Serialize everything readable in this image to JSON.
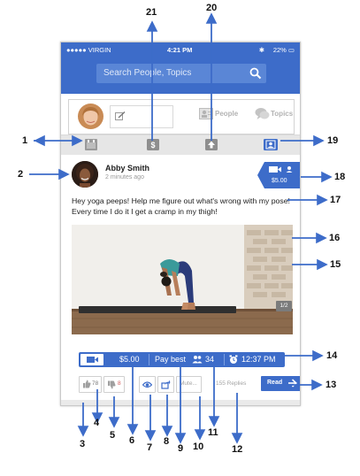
{
  "status_bar": {
    "carrier": "●●●●● VIRGIN",
    "time": "4:21 PM",
    "battery": "22%"
  },
  "search": {
    "placeholder": "Search People, Topics",
    "icon": "search-icon"
  },
  "compose": {
    "people_label": "People",
    "topics_label": "Topics"
  },
  "tabs": [
    {
      "icon": "calendar-icon",
      "selected": false
    },
    {
      "icon": "dollar-icon",
      "selected": false
    },
    {
      "icon": "upload-icon",
      "selected": false
    },
    {
      "icon": "profile-icon",
      "selected": true
    }
  ],
  "post": {
    "author": "Abby Smith",
    "time": "2 minutes ago",
    "body": "Hey yoga peeps! Help me figure out what's wrong with my pose! Every time I do it I get a cramp in my thigh!",
    "offer_price": "$5.00",
    "image_count": "1/2"
  },
  "info_bar": {
    "price": "$5.00",
    "pay_label": "Pay best",
    "participants": "34",
    "deadline": "12:37 PM"
  },
  "actions": {
    "likes": "78",
    "dislikes": "8",
    "mute_label": "Mute...",
    "replies": "155 Replies",
    "read_label": "Read"
  },
  "callouts": [
    "1",
    "2",
    "3",
    "4",
    "5",
    "6",
    "7",
    "8",
    "9",
    "10",
    "11",
    "12",
    "13",
    "14",
    "15",
    "16",
    "17",
    "18",
    "19",
    "20",
    "21"
  ],
  "colors": {
    "brand": "#3d6cc9",
    "tab_bg": "#e6e6e6",
    "tab_icon": "#9a9a9a"
  }
}
